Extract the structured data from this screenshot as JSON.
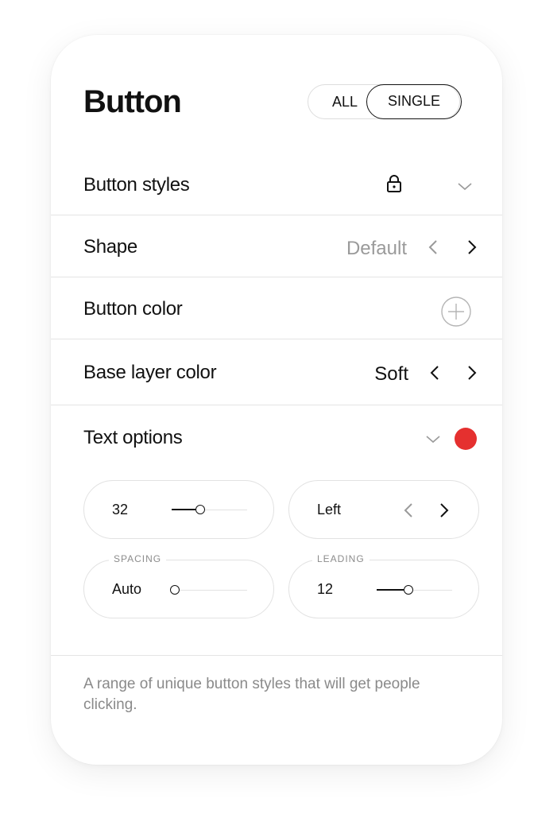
{
  "header": {
    "title": "Button",
    "toggle": {
      "all_label": "ALL",
      "single_label": "SINGLE",
      "selected": "SINGLE"
    }
  },
  "rows": {
    "button_styles": {
      "label": "Button styles",
      "lock_icon": "lock-icon",
      "expand_icon": "chevron-down-icon"
    },
    "shape": {
      "label": "Shape",
      "value": "Default"
    },
    "button_color": {
      "label": "Button color",
      "add_icon": "plus-circle-icon"
    },
    "base_layer_color": {
      "label": "Base layer color",
      "value": "Soft"
    },
    "text_options": {
      "label": "Text options",
      "indicator_color": "#e5302f"
    }
  },
  "text_controls": {
    "size": {
      "value": "32",
      "level": 0.45
    },
    "align": {
      "value": "Left"
    },
    "spacing": {
      "caption": "SPACING",
      "value": "Auto",
      "level": 0.0
    },
    "leading": {
      "caption": "LEADING",
      "value": "12",
      "level": 0.45
    }
  },
  "footer": {
    "description": "A range of unique button styles that will get people clicking."
  },
  "colors": {
    "accent": "#e5302f",
    "text": "#111111",
    "muted": "#9a9a9a",
    "divider": "#e4e4e4"
  }
}
